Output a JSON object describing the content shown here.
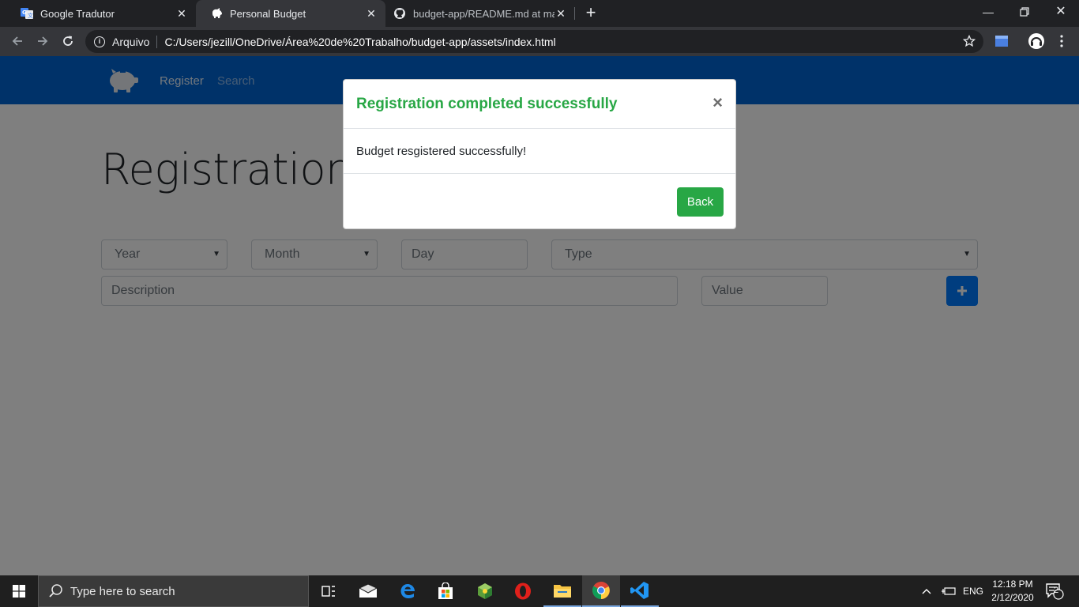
{
  "browser": {
    "tabs": [
      {
        "title": "Google Tradutor",
        "favicon": "google-translate-icon",
        "active": false
      },
      {
        "title": "Personal Budget",
        "favicon": "piggy-bank-icon",
        "active": true
      },
      {
        "title": "budget-app/README.md at mast",
        "favicon": "github-icon",
        "active": false
      }
    ],
    "new_tab_label": "+",
    "omnibox": {
      "security_chip": "Arquivo",
      "url": "C:/Users/jezill/OneDrive/Área%20de%20Trabalho/budget-app/assets/index.html"
    }
  },
  "app": {
    "nav": {
      "register": "Register",
      "search": "Search"
    },
    "heading": "Registration of expenses",
    "form": {
      "year": "Year",
      "month": "Month",
      "day_placeholder": "Day",
      "type": "Type",
      "description_placeholder": "Description",
      "value_placeholder": "Value"
    },
    "add_button_label": "+"
  },
  "modal": {
    "title": "Registration completed successfully",
    "close_label": "×",
    "message": "Budget resgistered successfully!",
    "back_label": "Back"
  },
  "taskbar": {
    "search_placeholder": "Type here to search",
    "language": "ENG",
    "time": "12:18 PM",
    "date": "2/12/2020",
    "notifications_count": "2"
  },
  "colors": {
    "navbar": "#0064d2",
    "success": "#28a745",
    "primary": "#007bff"
  }
}
